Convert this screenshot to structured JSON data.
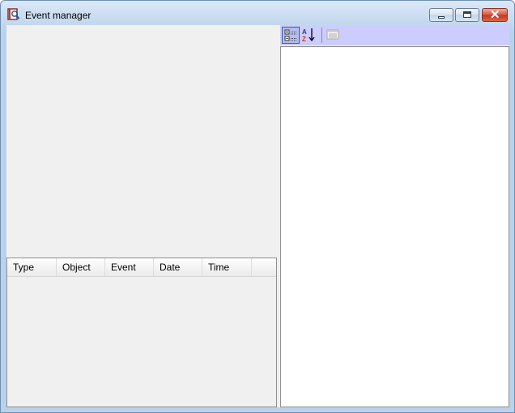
{
  "window": {
    "title": "Event manager",
    "icon": "event-manager-app-icon",
    "controls": [
      "minimize",
      "maximize",
      "close"
    ]
  },
  "event_list": {
    "columns": [
      "Type",
      "Object",
      "Event",
      "Date",
      "Time",
      ""
    ],
    "rows": []
  },
  "property_toolbar": {
    "buttons": [
      {
        "name": "categorized",
        "icon": "categorized-view-icon",
        "active": true
      },
      {
        "name": "alphabetical",
        "icon": "sort-az-icon",
        "active": false
      },
      {
        "name": "property-pages",
        "icon": "property-pages-icon",
        "active": false,
        "disabled": true
      }
    ],
    "background": "#ccccff"
  }
}
